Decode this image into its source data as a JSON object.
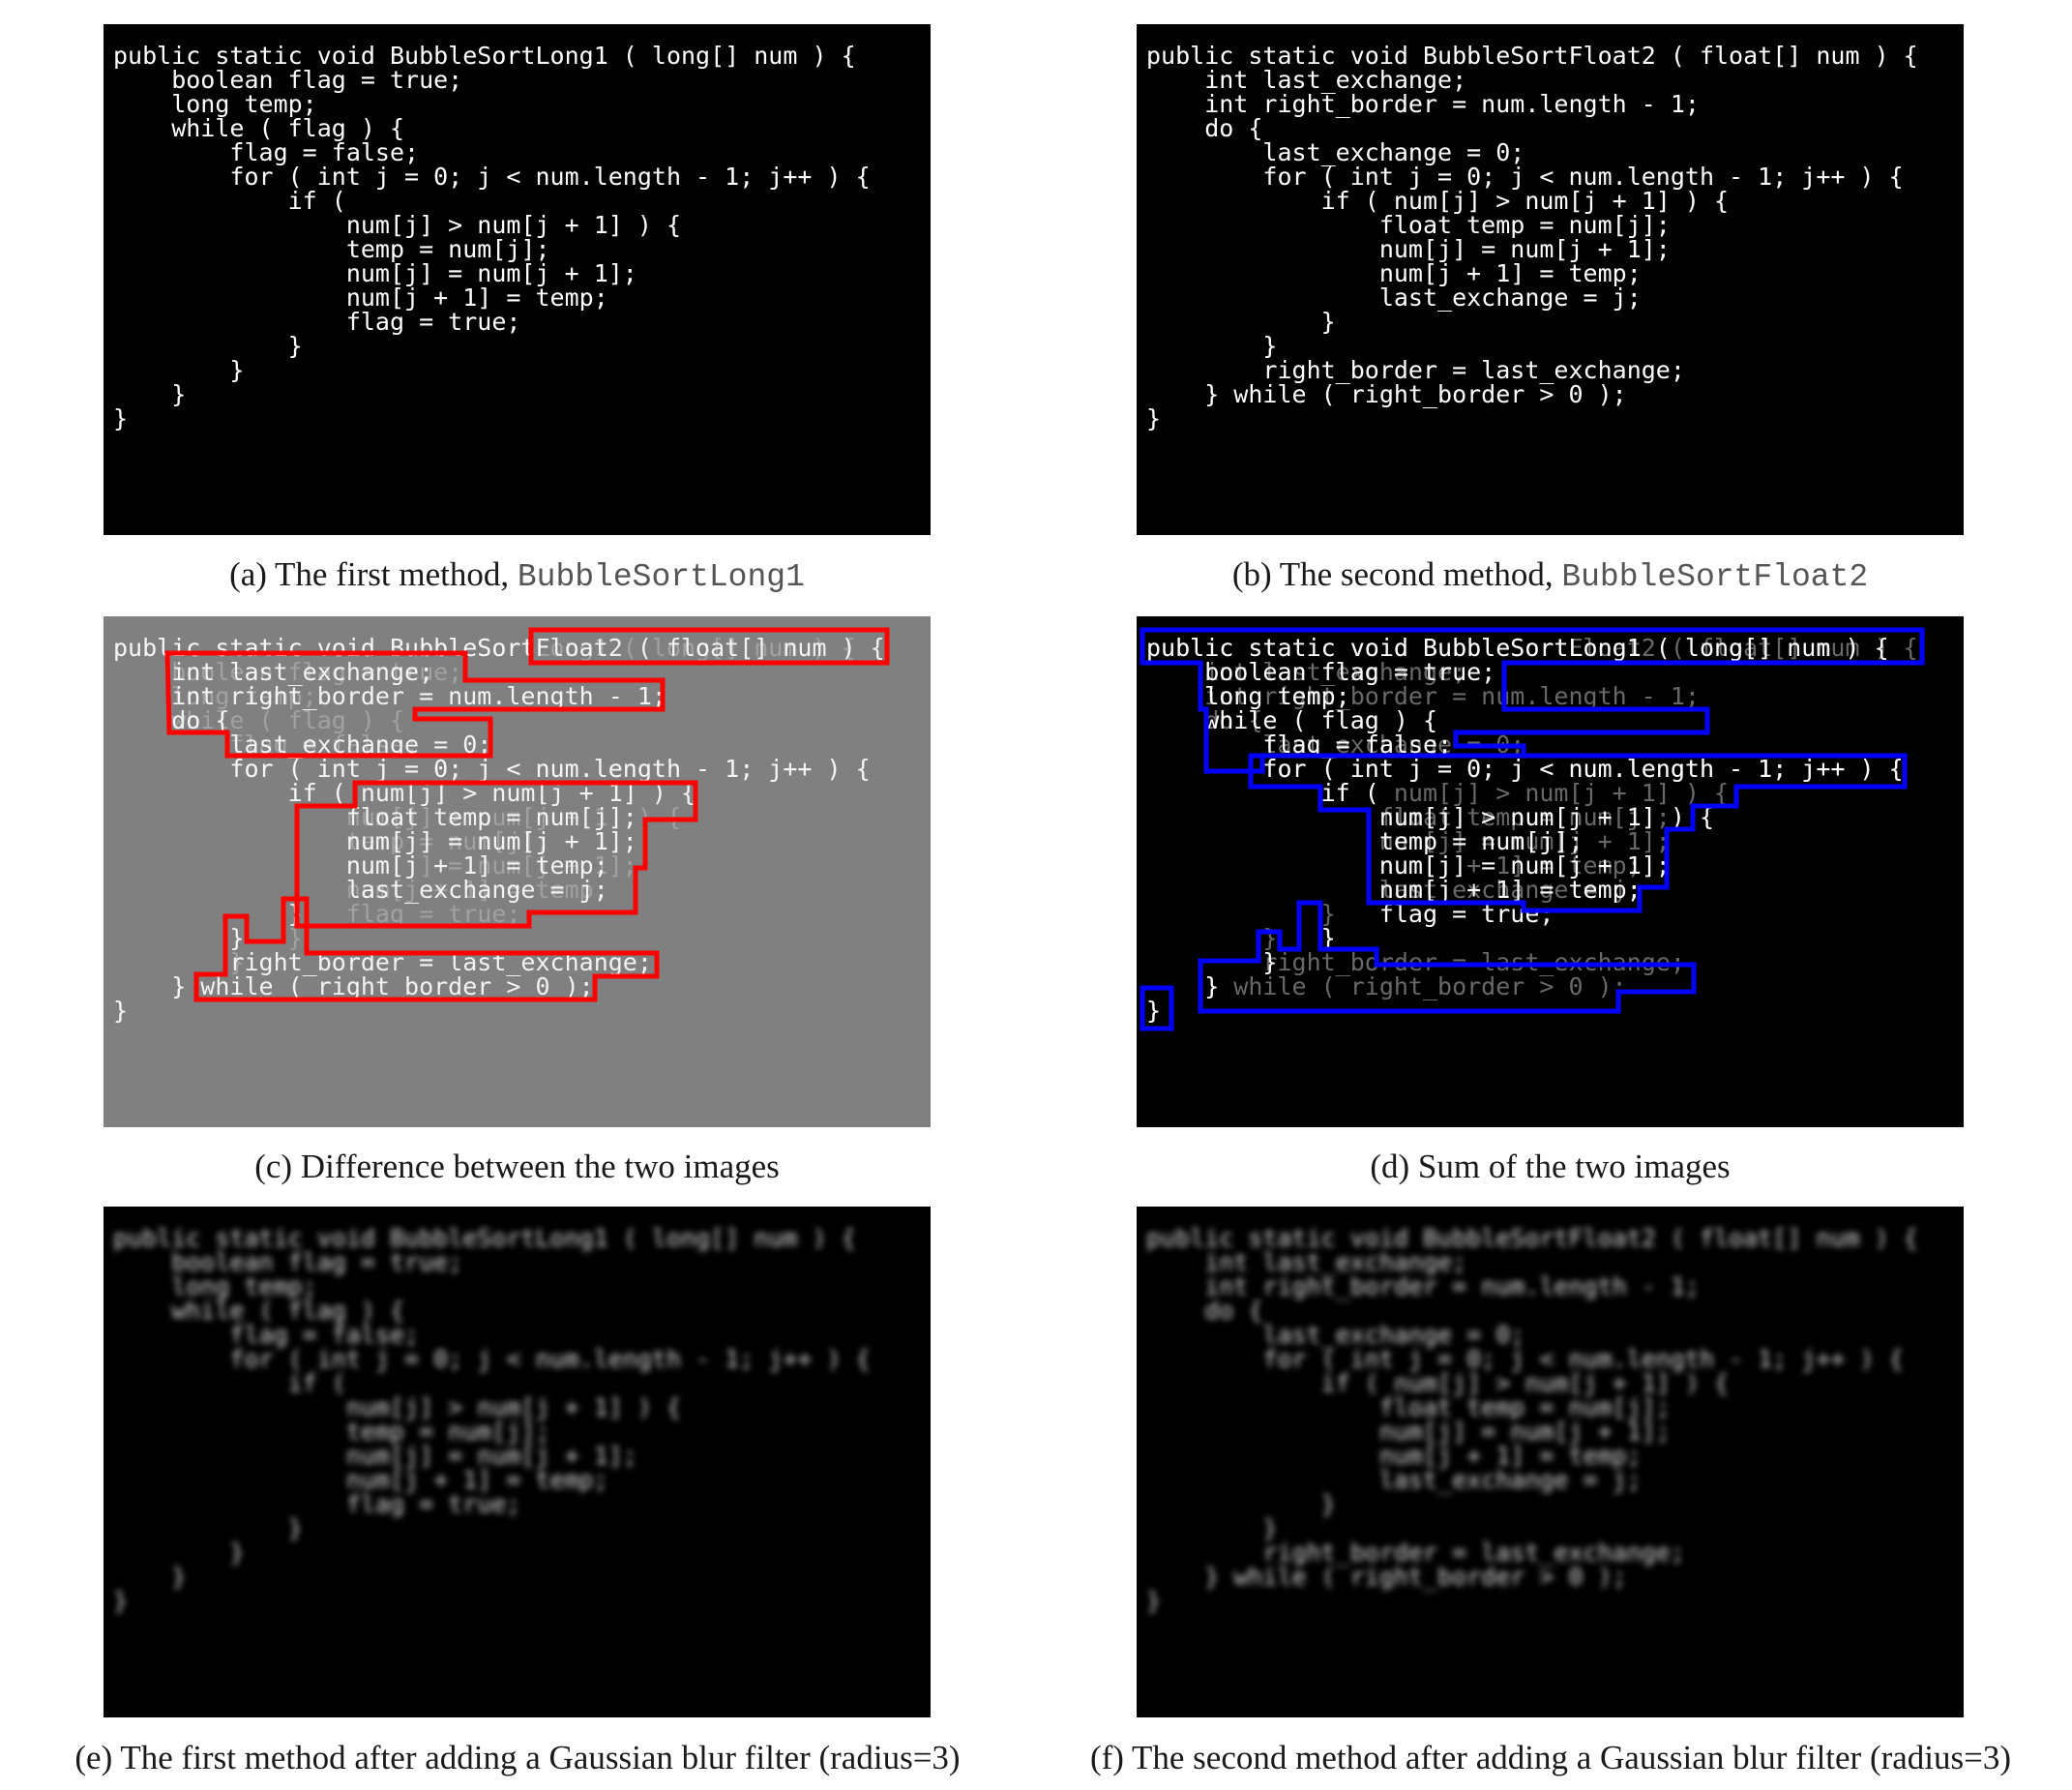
{
  "method1": {
    "lines": [
      "public static void BubbleSortLong1 ( long[] num ) {",
      "    boolean flag = true;",
      "    long temp;",
      "    while ( flag ) {",
      "        flag = false;",
      "        for ( int j = 0; j < num.length - 1; j++ ) {",
      "            if (",
      "                num[j] > num[j + 1] ) {",
      "                temp = num[j];",
      "                num[j] = num[j + 1];",
      "                num[j + 1] = temp;",
      "                flag = true;",
      "            }",
      "        }",
      "    }",
      "}"
    ]
  },
  "method2": {
    "lines": [
      "public static void BubbleSortFloat2 ( float[] num ) {",
      "    int last_exchange;",
      "    int right_border = num.length - 1;",
      "    do {",
      "        last_exchange = 0;",
      "        for ( int j = 0; j < num.length - 1; j++ ) {",
      "            if ( num[j] > num[j + 1] ) {",
      "                float temp = num[j];",
      "                num[j] = num[j + 1];",
      "                num[j + 1] = temp;",
      "                last_exchange = j;",
      "            }",
      "        }",
      "        right_border = last_exchange;",
      "    } while ( right_border > 0 );",
      "}"
    ]
  },
  "captions": {
    "a_prefix": "(a) The first method, ",
    "a_mono": "BubbleSortLong1",
    "b_prefix": "(b) The second method, ",
    "b_mono": "BubbleSortFloat2",
    "c": "(c) Difference between the two images",
    "d": "(d) Sum of the two images",
    "e": "(e) The first method after adding a Gaussian blur filter (radius=3)",
    "f": "(f) The second method after adding a Gaussian blur filter (radius=3)"
  },
  "colors": {
    "panel_bg": "#000000",
    "diff_bg": "#808080",
    "diff_outline": "#ff0000",
    "sum_outline": "#0000ff"
  }
}
